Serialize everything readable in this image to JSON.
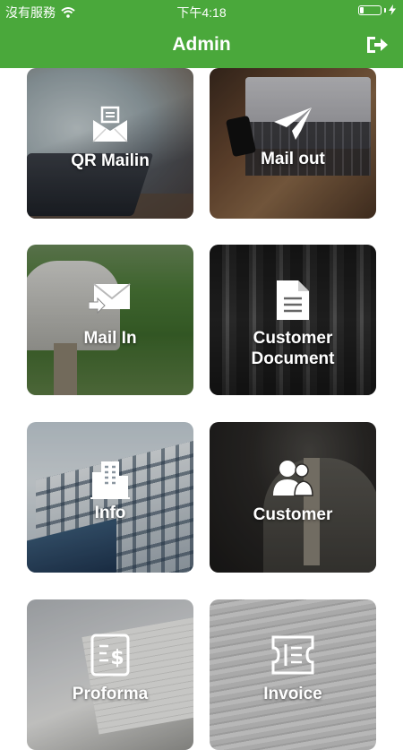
{
  "status_bar": {
    "carrier": "沒有服務",
    "time": "下午4:18",
    "battery_level": 0.2
  },
  "header": {
    "title": "Admin",
    "logout_icon": "logout-icon"
  },
  "tiles": [
    {
      "label": "QR Mailin",
      "icon": "mail-open-icon"
    },
    {
      "label": "Mail out",
      "icon": "paper-plane-icon"
    },
    {
      "label": "Mail In",
      "icon": "mail-in-icon"
    },
    {
      "label": "Customer\nDocument",
      "icon": "document-icon"
    },
    {
      "label": "Info",
      "icon": "building-icon"
    },
    {
      "label": "Customer",
      "icon": "users-icon"
    },
    {
      "label": "Proforma",
      "icon": "receipt-dollar-icon"
    },
    {
      "label": "Invoice",
      "icon": "invoice-icon"
    }
  ],
  "colors": {
    "header_green": "#4aa83b",
    "text_white": "#ffffff"
  }
}
